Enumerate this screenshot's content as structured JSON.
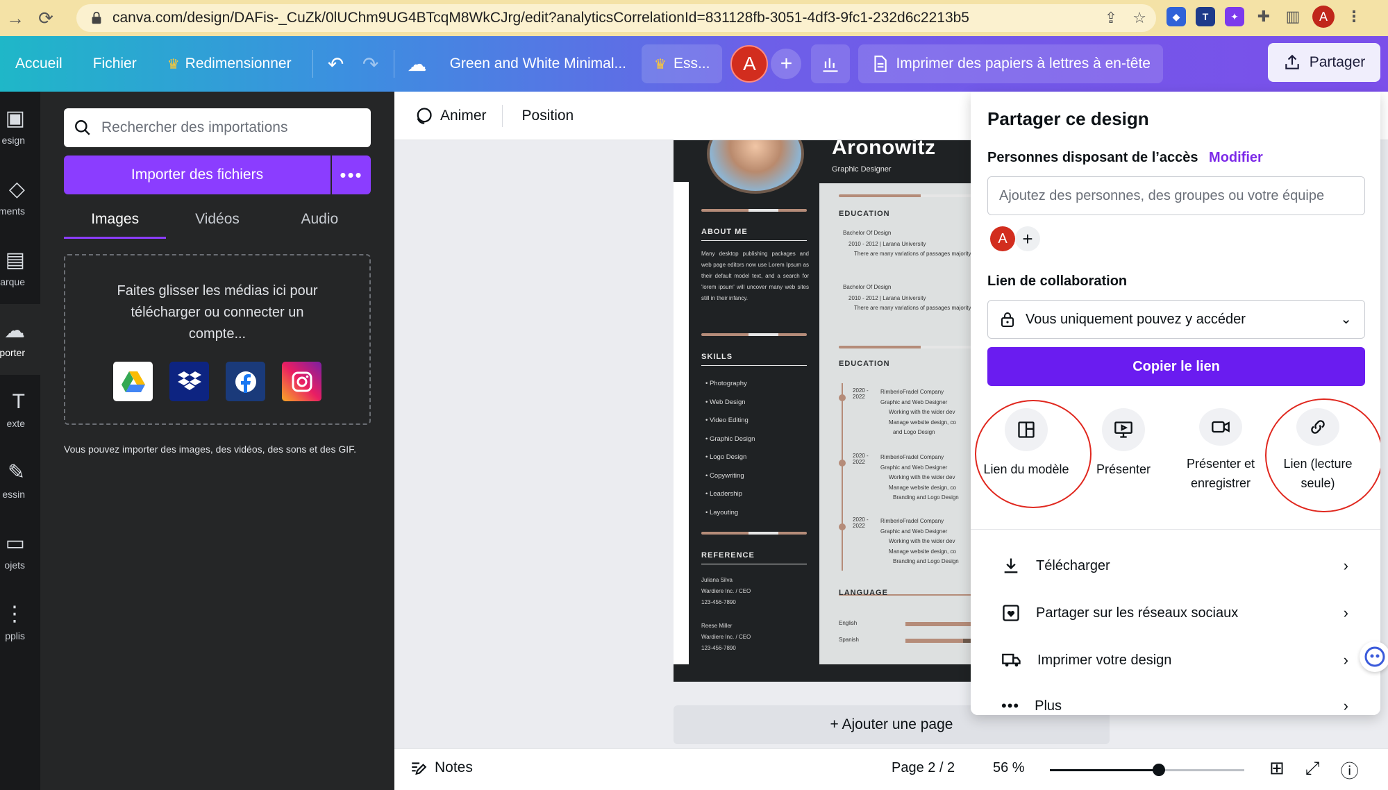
{
  "browser": {
    "url": "canva.com/design/DAFis-_CuZk/0lUChm9UG4BTcqM8WkCJrg/edit?analyticsCorrelationId=831128fb-3051-4df3-9fc1-232d6c2213b5",
    "avatar": "A"
  },
  "topbar": {
    "home": "Accueil",
    "file": "Fichier",
    "resize": "Redimensionner",
    "title": "Green and White Minimal...",
    "trial": "Ess...",
    "avatar": "A",
    "print": "Imprimer des papiers à lettres à en-tête",
    "share": "Partager"
  },
  "rail": {
    "items": [
      "esign",
      "ments",
      "arque",
      "porter",
      "exte",
      "essin",
      "ojets",
      "pplis"
    ]
  },
  "uploads": {
    "search_placeholder": "Rechercher des importations",
    "upload_button": "Importer des fichiers",
    "tabs": [
      "Images",
      "Vidéos",
      "Audio"
    ],
    "dropzone_text": "Faites glisser les médias ici pour télécharger ou connecter un compte...",
    "note": "Vous pouvez importer des images, des vidéos, des sons et des GIF."
  },
  "editor_toolbar": {
    "animate": "Animer",
    "position": "Position"
  },
  "resume": {
    "name": "Aronowitz",
    "role": "Graphic Designer",
    "about_heading": "ABOUT ME",
    "about_text": "Many desktop publishing packages and web page editors now use Lorem Ipsum as their default model text, and a search for 'lorem ipsum' will uncover many web sites still in their infancy.",
    "skills_heading": "SKILLS",
    "skills": [
      "Photography",
      "Web Design",
      "Video Editing",
      "Graphic Design",
      "Logo Design",
      "Copywriting",
      "Leadership",
      "Layouting"
    ],
    "reference_heading": "REFERENCE",
    "ref1_name": "Juliana Silva",
    "ref1_company": "Wardiere Inc. / CEO",
    "ref1_phone": "123-456-7890",
    "ref2_name": "Reese Miller",
    "ref2_company": "Wardiere Inc. / CEO",
    "ref2_phone": "123-456-7890",
    "education_heading": "EDUCATION",
    "edu1_degree": "Bachelor Of Design",
    "edu1_years": "2010 - 2012 | Larana University",
    "edu1_note": "There are many variations of passages majority.",
    "edu2_degree": "Bachelor Of Design",
    "edu2_years": "2010 - 2012 | Larana University",
    "edu2_note": "There are many variations of passages majority.",
    "experience_heading": "EDUCATION",
    "jobs": [
      {
        "years": "2020 - 2022",
        "company": "RimberioFradel Company",
        "title": "Graphic and Web Designer",
        "bullet1": "Working with the wider dev",
        "bullet2": "Manage website design, co",
        "bullet3": "and Logo Design"
      },
      {
        "years": "2020 - 2022",
        "company": "RimberioFradel Company",
        "title": "Graphic and Web Designer",
        "bullet1": "Working with the wider dev",
        "bullet2": "Manage website design, co",
        "bullet3": "Branding and Logo Design"
      },
      {
        "years": "2020 - 2022",
        "company": "RimberioFradel Company",
        "title": "Graphic and Web Designer",
        "bullet1": "Working with the wider dev",
        "bullet2": "Manage website design, co",
        "bullet3": "Branding and Logo Design"
      }
    ],
    "language_heading": "LANGUAGE",
    "languages": [
      "English",
      "Spanish"
    ]
  },
  "add_page": "+ Ajouter une page",
  "status": {
    "notes": "Notes",
    "page": "Page 2 / 2",
    "zoom": "56 %",
    "zoom_fraction": 0.56
  },
  "share_panel": {
    "title": "Partager ce design",
    "access_label": "Personnes disposant de l’accès",
    "modify": "Modifier",
    "people_placeholder": "Ajoutez des personnes, des groupes ou votre équipe",
    "avatar": "A",
    "collab_label": "Lien de collaboration",
    "collab_value": "Vous uniquement pouvez y accéder",
    "copy_button": "Copier le lien",
    "options": [
      "Lien du modèle",
      "Présenter",
      "Présenter et enregistrer",
      "Lien (lecture seule)"
    ],
    "rows": [
      "Télécharger",
      "Partager sur les réseaux sociaux",
      "Imprimer votre design",
      "Plus"
    ]
  },
  "colors": {
    "accent": "#8b3dff",
    "copy_button": "#6a1cf0",
    "highlight_ring": "#e0281f"
  }
}
